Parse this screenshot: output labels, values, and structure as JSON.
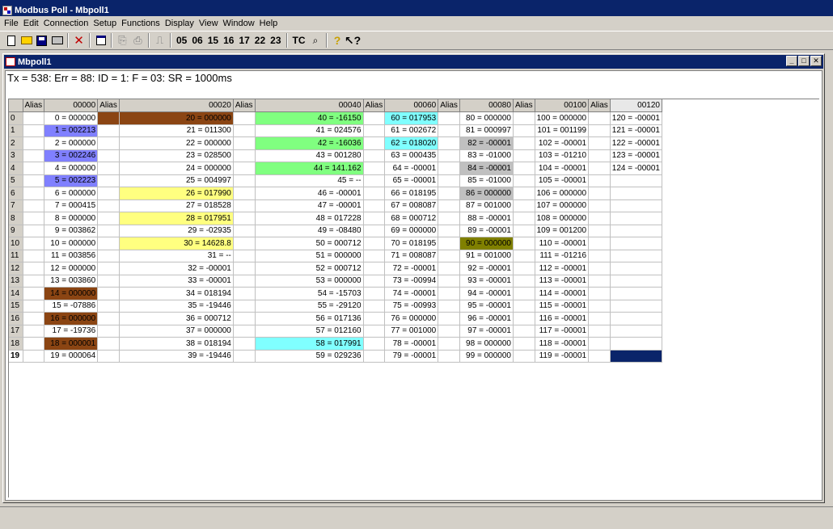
{
  "app": {
    "title": "Modbus Poll - Mbpoll1"
  },
  "menu": [
    "File",
    "Edit",
    "Connection",
    "Setup",
    "Functions",
    "Display",
    "View",
    "Window",
    "Help"
  ],
  "toolbar": {
    "function_codes": [
      "05",
      "06",
      "15",
      "16",
      "17",
      "22",
      "23"
    ],
    "tc_label": "TC"
  },
  "child": {
    "title": "Mbpoll1",
    "status": "Tx = 538: Err = 88: ID = 1: F = 03: SR = 1000ms"
  },
  "grid": {
    "alias_header": "Alias",
    "column_headers": [
      "00000",
      "00020",
      "00040",
      "00060",
      "00080",
      "00100",
      "00120"
    ],
    "row_numbers": [
      "0",
      "1",
      "2",
      "3",
      "4",
      "5",
      "6",
      "7",
      "8",
      "9",
      "10",
      "11",
      "12",
      "13",
      "14",
      "15",
      "16",
      "17",
      "18",
      "19"
    ],
    "columns": [
      [
        "0 = 000000",
        "1 = 002213",
        "2 = 000000",
        "3 = 002246",
        "4 = 000000",
        "5 = 002223",
        "6 = 000000",
        "7 = 000415",
        "8 = 000000",
        "9 = 003862",
        "10 = 000000",
        "11 = 003856",
        "12 = 000000",
        "13 = 003860",
        "14 = 000000",
        "15 = -07886",
        "16 = 000000",
        "17 = -19736",
        "18 = 000001",
        "19 = 000064"
      ],
      [
        "20 = 000000",
        "21 = 011300",
        "22 = 000000",
        "23 = 028500",
        "24 = 000000",
        "25 = 004997",
        "26 = 017990",
        "27 = 018528",
        "28 = 017951",
        "29 = -02935",
        "30 = 14628.8",
        "31 = --",
        "32 = -00001",
        "33 = -00001",
        "34 = 018194",
        "35 = -19446",
        "36 = 000712",
        "37 = 000000",
        "38 = 018194",
        "39 = -19446"
      ],
      [
        "40 = -16150",
        "41 = 024576",
        "42 = -16036",
        "43 = 001280",
        "44 = 141.162",
        "45 = --",
        "46 = -00001",
        "47 = -00001",
        "48 = 017228",
        "49 = -08480",
        "50 = 000712",
        "51 = 000000",
        "52 = 000712",
        "53 = 000000",
        "54 = -15703",
        "55 = -29120",
        "56 = 017136",
        "57 = 012160",
        "58 = 017991",
        "59 = 029236"
      ],
      [
        "60 = 017953",
        "61 = 002672",
        "62 = 018020",
        "63 = 000435",
        "64 = -00001",
        "65 = -00001",
        "66 = 018195",
        "67 = 008087",
        "68 = 000712",
        "69 = 000000",
        "70 = 018195",
        "71 = 008087",
        "72 = -00001",
        "73 = -00994",
        "74 = -00001",
        "75 = -00993",
        "76 = 000000",
        "77 = 001000",
        "78 = -00001",
        "79 = -00001"
      ],
      [
        "80 = 000000",
        "81 = 000997",
        "82 = -00001",
        "83 = -01000",
        "84 = -00001",
        "85 = -01000",
        "86 = 000000",
        "87 = 001000",
        "88 = -00001",
        "89 = -00001",
        "90 = 000000",
        "91 = 001000",
        "92 = -00001",
        "93 = -00001",
        "94 = -00001",
        "95 = -00001",
        "96 = -00001",
        "97 = -00001",
        "98 = 000000",
        "99 = 000000"
      ],
      [
        "100 = 000000",
        "101 = 001199",
        "102 = -00001",
        "103 = -01210",
        "104 = -00001",
        "105 = -00001",
        "106 = 000000",
        "107 = 000000",
        "108 = 000000",
        "109 = 001200",
        "110 = -00001",
        "111 = -01216",
        "112 = -00001",
        "113 = -00001",
        "114 = -00001",
        "115 = -00001",
        "116 = -00001",
        "117 = -00001",
        "118 = -00001",
        "119 = -00001"
      ],
      [
        "120 = -00001",
        "121 = -00001",
        "122 = -00001",
        "123 = -00001",
        "124 = -00001",
        "",
        "",
        "",
        "",
        "",
        "",
        "",
        "",
        "",
        "",
        "",
        "",
        "",
        "",
        ""
      ]
    ],
    "highlight_colors": {
      "brown": "#8b4513",
      "blue": "#8080ff",
      "yellow": "#ffff80",
      "green": "#80ff80",
      "cyan": "#80ffff",
      "gray": "#c0c0c0",
      "olive": "#808000",
      "navy": "#0a246a"
    }
  }
}
